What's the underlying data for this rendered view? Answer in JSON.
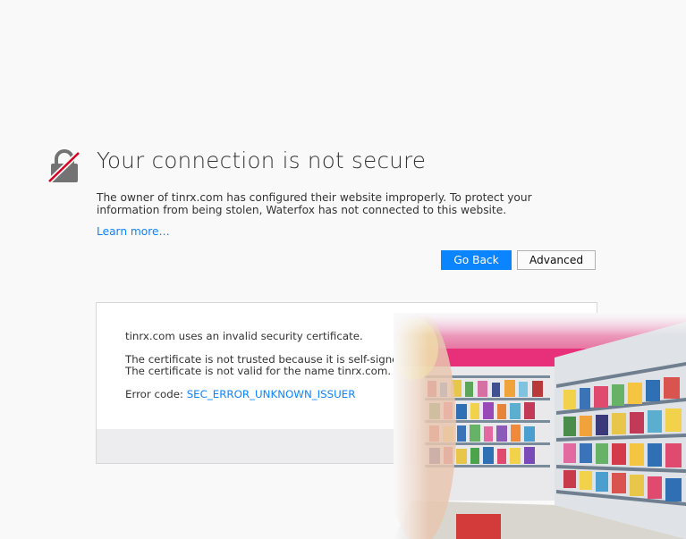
{
  "title": "Your connection is not secure",
  "description": "The owner of tinrx.com has configured their website improperly. To protect your information from being stolen, Waterfox has not connected to this website.",
  "learn_more": "Learn more…",
  "buttons": {
    "go_back": "Go Back",
    "advanced": "Advanced"
  },
  "details": {
    "line1": "tinrx.com uses an invalid security certificate.",
    "line2": "The certificate is not trusted because it is self-signed.",
    "line3": "The certificate is not valid for the name tinrx.com.",
    "error_label": "Error code: ",
    "error_code": "SEC_ERROR_UNKNOWN_ISSUER"
  },
  "icons": {
    "warning": "broken-lock-icon"
  },
  "colors": {
    "accent": "#0a84ff",
    "lock_gray": "#737373",
    "slash_red": "#d70022",
    "page_bg": "#f9f9fa"
  }
}
